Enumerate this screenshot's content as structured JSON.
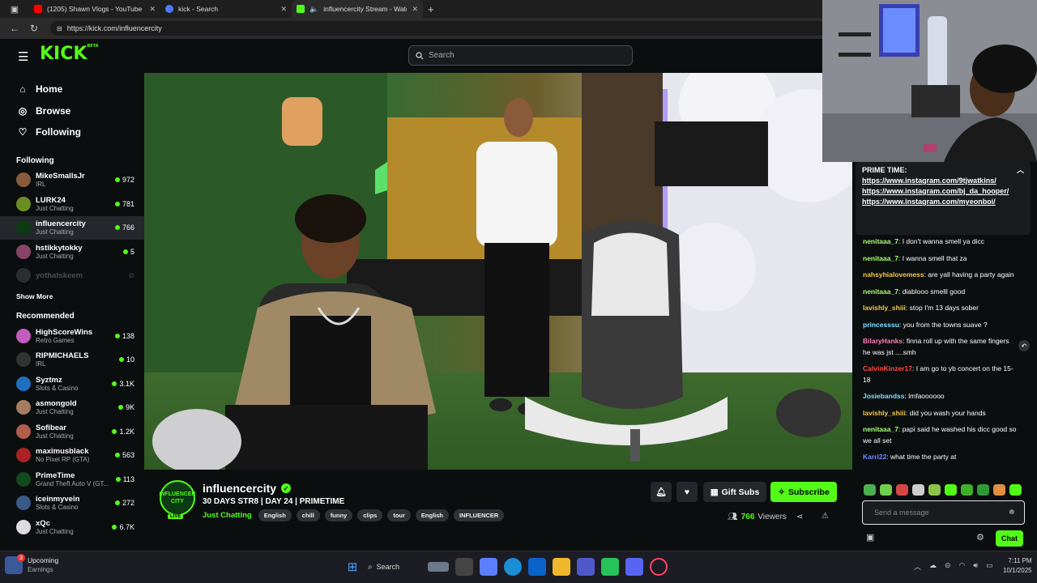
{
  "browser": {
    "tabs": [
      {
        "title": "(1205) Shawn Vlogs - YouTube",
        "color": "#ff0000"
      },
      {
        "title": "kick - Search",
        "color": "#4d7cff"
      },
      {
        "title": "influencercity Stream - Watc",
        "color": "#53fc18"
      }
    ],
    "url": "https://kick.com/influencercity"
  },
  "kick": {
    "logo": "KICK",
    "logo_sup": "BETA",
    "search_placeholder": "Search",
    "nav": [
      {
        "label": "Home",
        "icon": "home-icon"
      },
      {
        "label": "Browse",
        "icon": "compass-icon"
      },
      {
        "label": "Following",
        "icon": "heart-icon"
      }
    ],
    "following_title": "Following",
    "following": [
      {
        "name": "MikeSmallsJr",
        "cat": "IRL",
        "viewers": "972",
        "color": "#8a5a3c"
      },
      {
        "name": "LURK24",
        "cat": "Just Chatting",
        "viewers": "781",
        "color": "#6b8e23"
      },
      {
        "name": "influencercity",
        "cat": "Just Chatting",
        "viewers": "766",
        "color": "#0c3a12"
      },
      {
        "name": "hstikkytokky",
        "cat": "Just Chatting",
        "viewers": "5",
        "color": "#884466"
      }
    ],
    "offline": {
      "name": "yothatskeem"
    },
    "show_more": "Show More",
    "recommended_title": "Recommended",
    "recommended": [
      {
        "name": "HighScoreWins",
        "cat": "Retro Games",
        "viewers": "138",
        "color": "#c45bbf"
      },
      {
        "name": "RIPMICHAELS",
        "cat": "IRL",
        "viewers": "10",
        "color": "#333"
      },
      {
        "name": "Syztmz",
        "cat": "Slots & Casino",
        "viewers": "3.1K",
        "color": "#1e6fbf"
      },
      {
        "name": "asmongold",
        "cat": "Just Chatting",
        "viewers": "9K",
        "color": "#a87c5f"
      },
      {
        "name": "Sofibear",
        "cat": "Just Chatting",
        "viewers": "1.2K",
        "color": "#b05d4c"
      },
      {
        "name": "maximusblack",
        "cat": "No Pixel RP (GTA)",
        "viewers": "563",
        "color": "#aa2222"
      },
      {
        "name": "PrimeTime",
        "cat": "Grand Theft Auto V (GT...",
        "viewers": "113",
        "color": "#114a1c"
      },
      {
        "name": "iceinmyvein",
        "cat": "Slots & Casino",
        "viewers": "272",
        "color": "#3a5a8a"
      },
      {
        "name": "xQc",
        "cat": "Just Chatting",
        "viewers": "6.7K",
        "color": "#ddd"
      }
    ],
    "stream": {
      "name": "influencercity",
      "title": "30 DAYS STR8 | DAY 24 | PRIMETIME",
      "category": "Just Chatting",
      "tags": [
        "English",
        "chill",
        "funny",
        "clips",
        "tour",
        "English",
        "INFLUENCER"
      ],
      "gift_label": "Gift Subs",
      "subscribe_label": "Subscribe",
      "viewers": "766",
      "viewers_label": "Viewers",
      "avatar_text": "INFLUENCER CITY",
      "live": "LIVE"
    },
    "chat": {
      "pinned_title": "PRIME TIME:",
      "pinned_links": [
        "https://www.instagram.com/9tjwatkins/",
        "https://www.instagram.com/bj_da_hooper/",
        "https://www.instagram.com/myeonboi/"
      ],
      "messages": [
        {
          "user": "nenitaaa_7",
          "color": "#a6ff70",
          "text": "I don't wanna smell ya dicc"
        },
        {
          "user": "nenitaaa_7",
          "color": "#a6ff70",
          "text": "I wanna smell that za"
        },
        {
          "user": "nahsyhialovemess",
          "color": "#f7c948",
          "text": "are yall having a party again"
        },
        {
          "user": "nenitaaa_7",
          "color": "#a6ff70",
          "text": "diablooo smelll good"
        },
        {
          "user": "lavishly_shiii",
          "color": "#f7c948",
          "text": "stop I'm 13 days sober"
        },
        {
          "user": "princesssu",
          "color": "#7ee0ff",
          "text": "you from the towns suave ?"
        },
        {
          "user": "BilaryHanks",
          "color": "#ff7eb6",
          "text": "finna roll up with the same fingers he was jst ....smh"
        },
        {
          "user": "CalvinKinzer17",
          "color": "#ff4d4d",
          "text": "I am go to yb concert on the 15-18"
        },
        {
          "user": "Josiebandss",
          "color": "#7ee0ff",
          "text": "lmfaoooooo"
        },
        {
          "user": "lavishly_shiii",
          "color": "#f7c948",
          "text": "did you wash your hands"
        },
        {
          "user": "nenitaaa_7",
          "color": "#a6ff70",
          "text": "papi said he washed his dicc good so we all set"
        },
        {
          "user": "Karri22",
          "color": "#6e8bff",
          "text": "what time the party at"
        }
      ],
      "input_placeholder": "Send a message",
      "chat_button": "Chat"
    }
  },
  "taskbar": {
    "widget_title": "Upcoming",
    "widget_sub": "Earnings",
    "widget_badge": "3",
    "search_label": "Search",
    "time": "7:11 PM",
    "date": "10/1/2025"
  }
}
